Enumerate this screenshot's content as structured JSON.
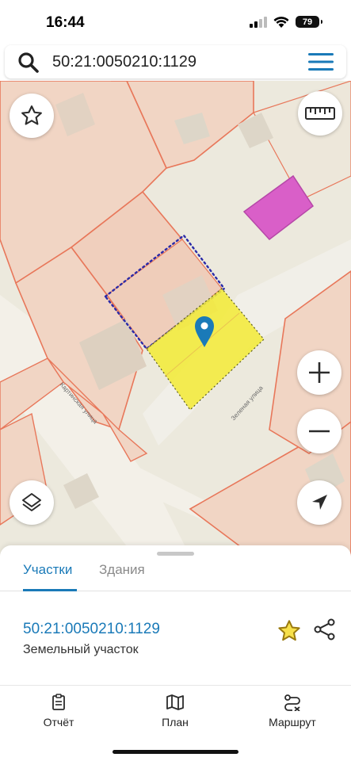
{
  "status_bar": {
    "time": "16:44",
    "battery": "79"
  },
  "search": {
    "query": "50:21:0050210:1129"
  },
  "map": {
    "street_labels": {
      "kartinskaya": "Картинская улица",
      "zelenaya": "Зеленая улица"
    },
    "colors": {
      "parcel_border": "#e8775a",
      "selected_parcel": "#f2ea3a",
      "neighbour_outline": "#2a2aa8",
      "building": "#d95fc8",
      "pin": "#1a7ab8"
    }
  },
  "sheet": {
    "tabs": [
      {
        "label": "Участки",
        "active": true
      },
      {
        "label": "Здания",
        "active": false
      }
    ],
    "parcel": {
      "number": "50:21:0050210:1129",
      "type": "Земельный участок"
    }
  },
  "bottom_nav": {
    "items": [
      {
        "label": "Отчёт",
        "icon": "report-icon"
      },
      {
        "label": "План",
        "icon": "map-plan-icon"
      },
      {
        "label": "Маршрут",
        "icon": "route-icon"
      }
    ]
  }
}
